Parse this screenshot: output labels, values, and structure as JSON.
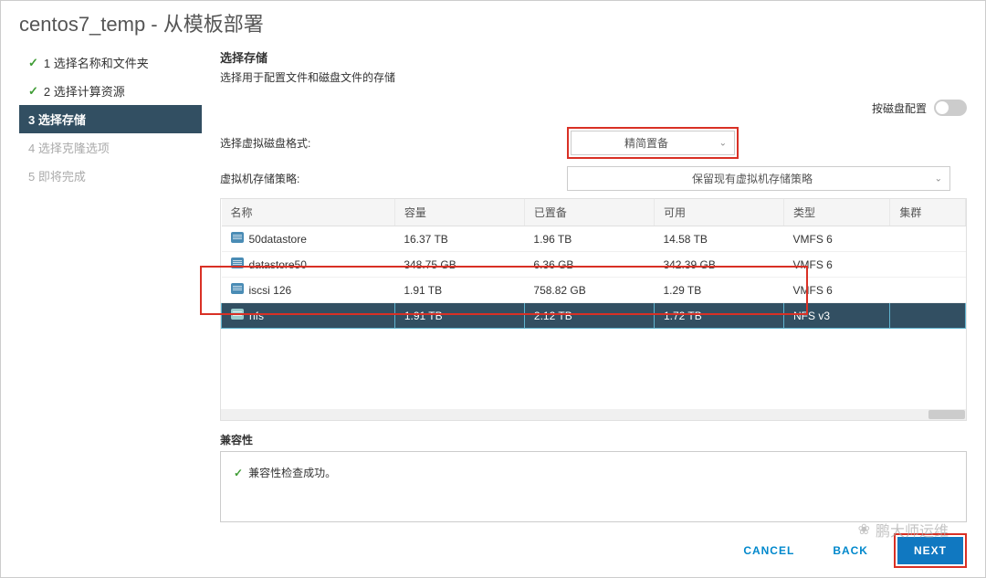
{
  "dialog": {
    "title": "centos7_temp - 从模板部署"
  },
  "steps": [
    {
      "num": "1",
      "label": "选择名称和文件夹",
      "state": "done"
    },
    {
      "num": "2",
      "label": "选择计算资源",
      "state": "done"
    },
    {
      "num": "3",
      "label": "选择存储",
      "state": "active"
    },
    {
      "num": "4",
      "label": "选择克隆选项",
      "state": "disabled"
    },
    {
      "num": "5",
      "label": "即将完成",
      "state": "disabled"
    }
  ],
  "section": {
    "title": "选择存储",
    "desc": "选择用于配置文件和磁盘文件的存储"
  },
  "config": {
    "perDiskLabel": "按磁盘配置",
    "diskFormatLabel": "选择虚拟磁盘格式:",
    "diskFormatValue": "精简置备",
    "policyLabel": "虚拟机存储策略:",
    "policyValue": "保留现有虚拟机存储策略"
  },
  "table": {
    "headers": [
      "名称",
      "容量",
      "已置备",
      "可用",
      "类型",
      "集群"
    ],
    "rows": [
      {
        "name": "50datastore",
        "capacity": "16.37 TB",
        "provisioned": "1.96 TB",
        "free": "14.58 TB",
        "type": "VMFS 6",
        "cluster": "",
        "selected": false
      },
      {
        "name": "datastore50",
        "capacity": "348.75 GB",
        "provisioned": "6.36 GB",
        "free": "342.39 GB",
        "type": "VMFS 6",
        "cluster": "",
        "selected": false
      },
      {
        "name": "iscsi 126",
        "capacity": "1.91 TB",
        "provisioned": "758.82 GB",
        "free": "1.29 TB",
        "type": "VMFS 6",
        "cluster": "",
        "selected": false
      },
      {
        "name": "nfs",
        "capacity": "1.91 TB",
        "provisioned": "2.12 TB",
        "free": "1.72 TB",
        "type": "NFS v3",
        "cluster": "",
        "selected": true
      }
    ]
  },
  "compat": {
    "title": "兼容性",
    "message": "兼容性检查成功。"
  },
  "footer": {
    "cancel": "CANCEL",
    "back": "BACK",
    "next": "NEXT"
  },
  "watermark": "鹏大师运维"
}
